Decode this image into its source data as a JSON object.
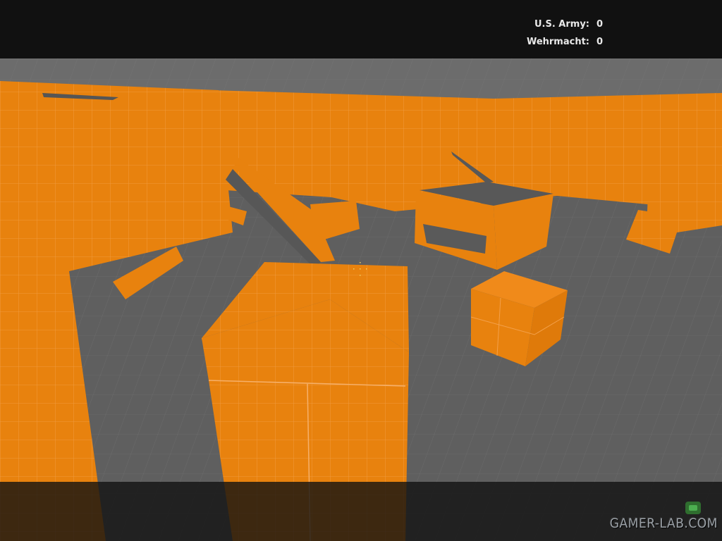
{
  "hud": {
    "scoreboard": [
      {
        "team": "U.S. Army:",
        "score": "0"
      },
      {
        "team": "Wehrmacht:",
        "score": "0"
      }
    ]
  },
  "watermark": {
    "text": "GAMER-LAB.COM"
  },
  "colors": {
    "dev_texture_orange": "#e8820e",
    "floor_gray": "#616161",
    "sky_gray": "#6f6f6f",
    "letterbox": "#111111",
    "hud_text": "#e9e9e9"
  },
  "icons": {
    "crosshair": "crosshair-icon",
    "watermark_logo": "gamer-lab-logo-icon"
  }
}
